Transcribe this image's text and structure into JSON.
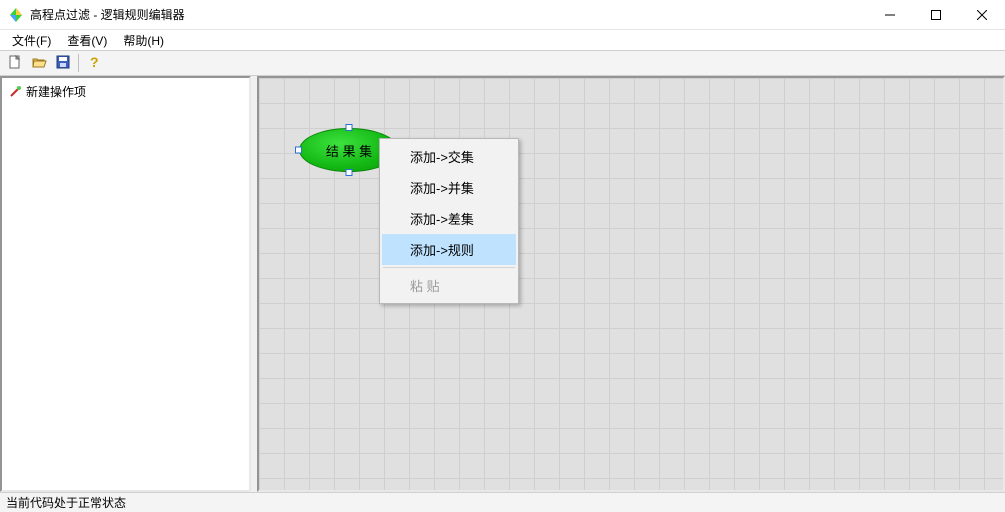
{
  "window": {
    "title": "高程点过滤 - 逻辑规则编辑器"
  },
  "menubar": {
    "items": [
      {
        "label": "文件(F)"
      },
      {
        "label": "查看(V)"
      },
      {
        "label": "帮助(H)"
      }
    ]
  },
  "toolbar": {
    "new_name": "new-file-icon",
    "open_name": "open-file-icon",
    "save_name": "save-file-icon",
    "help_name": "help-icon"
  },
  "sidebar": {
    "root": {
      "label": "新建操作项"
    }
  },
  "canvas": {
    "node": {
      "label": "结 果 集"
    }
  },
  "context_menu": {
    "items": [
      {
        "label": "添加->交集",
        "highlighted": false,
        "disabled": false
      },
      {
        "label": "添加->并集",
        "highlighted": false,
        "disabled": false
      },
      {
        "label": "添加->差集",
        "highlighted": false,
        "disabled": false
      },
      {
        "label": "添加->规则",
        "highlighted": true,
        "disabled": false
      },
      {
        "label": "粘  贴",
        "highlighted": false,
        "disabled": true,
        "separator_before": true
      }
    ]
  },
  "statusbar": {
    "text": "当前代码处于正常状态"
  }
}
